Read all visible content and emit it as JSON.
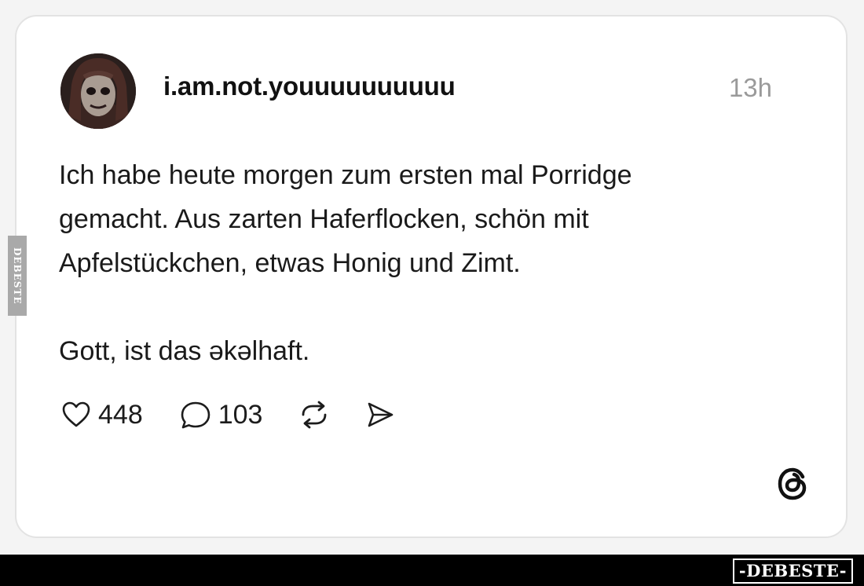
{
  "post": {
    "username": "i.am.not.youuuuuuuuuu",
    "timestamp": "13h",
    "text_lines": [
      "Ich habe heute morgen zum ersten mal Porridge",
      "gemacht. Aus zarten Haferflocken, schön mit",
      "Apfelstückchen, etwas Honig und Zimt."
    ],
    "text_final": "Gott, ist das əkəlhaft.",
    "likes": "448",
    "comments": "103"
  },
  "icons": {
    "like": "heart-icon",
    "comment": "comment-bubble-icon",
    "repost": "repost-icon",
    "share": "send-icon",
    "brand": "threads-logo-icon"
  },
  "watermark": {
    "side_text": "DEBESTE",
    "footer_text": "-DEBESTE-"
  },
  "colors": {
    "page_background": "#f4f4f4",
    "card_background": "#ffffff",
    "timestamp": "#9a9a9a",
    "footer_bar": "#000000"
  }
}
